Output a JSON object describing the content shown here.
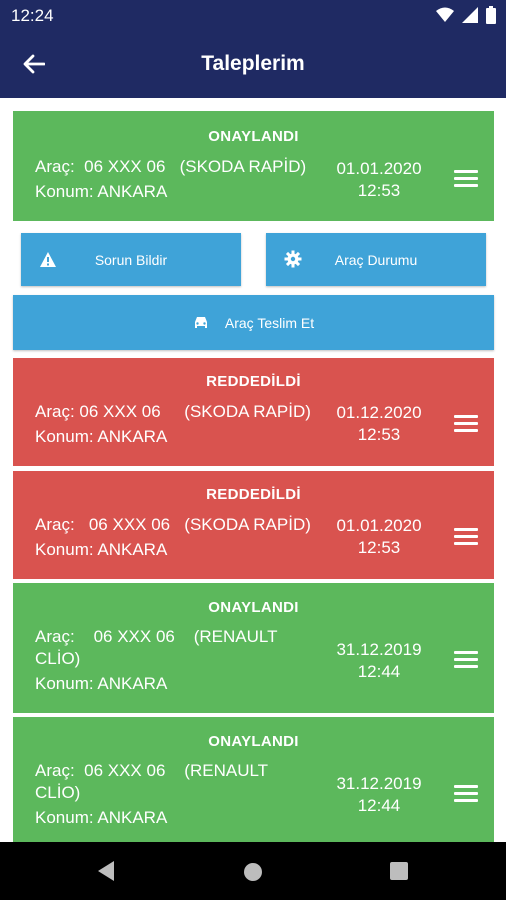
{
  "status_bar": {
    "time": "12:24"
  },
  "app_bar": {
    "title": "Taleplerim"
  },
  "actions": {
    "report_problem": "Sorun Bildir",
    "vehicle_status": "Araç Durumu",
    "deliver_vehicle": "Araç Teslim Et"
  },
  "requests": [
    {
      "status": "ONAYLANDI",
      "vehicle_text": "Araç:  06 XXX 06   (SKODA RAPİD)",
      "location": "Konum: ANKARA",
      "date": "01.01.2020",
      "time": "12:53",
      "color": "#5cb85c"
    },
    {
      "status": "REDDEDİLDİ",
      "vehicle_text": "Araç: 06 XXX 06     (SKODA RAPİD)",
      "location": "Konum: ANKARA",
      "date": "01.12.2020",
      "time": "12:53",
      "color": "#d9534f"
    },
    {
      "status": "REDDEDİLDİ",
      "vehicle_text": "Araç:   06 XXX 06   (SKODA RAPİD)",
      "location": "Konum: ANKARA",
      "date": "01.01.2020",
      "time": "12:53",
      "color": "#d9534f"
    },
    {
      "status": "ONAYLANDI",
      "vehicle_text": "Araç:    06 XXX 06    (RENAULT\nCLİO)",
      "location": "Konum: ANKARA",
      "date": "31.12.2019",
      "time": "12:44",
      "color": "#5cb85c"
    },
    {
      "status": "ONAYLANDI",
      "vehicle_text": "Araç:  06 XXX 06    (RENAULT\nCLİO)",
      "location": "Konum: ANKARA",
      "date": "31.12.2019",
      "time": "12:44",
      "color": "#5cb85c"
    }
  ]
}
